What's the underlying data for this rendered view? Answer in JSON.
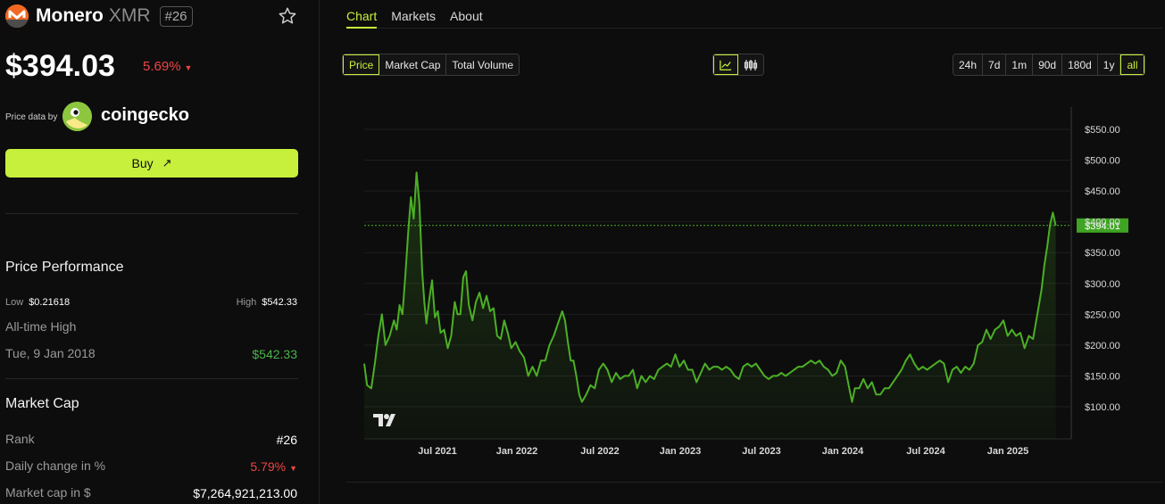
{
  "coin": {
    "name": "Monero",
    "symbol": "XMR",
    "rank": "#26",
    "price": "$394.03",
    "change": "5.69%",
    "price_data_by": "Price data by",
    "provider": "coingecko",
    "buy_label": "Buy",
    "brand_color": "#f26822",
    "accent_color": "#c7f03c"
  },
  "performance": {
    "title": "Price Performance",
    "low_label": "Low",
    "low_value": "$0.21618",
    "high_label": "High",
    "high_value": "$542.33",
    "ath_label": "All-time High",
    "ath_date": "Tue, 9 Jan 2018",
    "ath_value": "$542.33"
  },
  "market_cap": {
    "title": "Market Cap",
    "rank_label": "Rank",
    "rank_value": "#26",
    "daily_label": "Daily change in %",
    "daily_value": "5.79%",
    "cap_label": "Market cap in $",
    "cap_value": "$7,264,921,213.00"
  },
  "tabs": [
    "Chart",
    "Markets",
    "About"
  ],
  "metric_buttons": [
    "Price",
    "Market Cap",
    "Total Volume"
  ],
  "chart_type_icons": [
    "line-chart-icon",
    "candlestick-icon"
  ],
  "range_buttons": [
    "24h",
    "7d",
    "1m",
    "90d",
    "180d",
    "1y",
    "all"
  ],
  "chart_data": {
    "type": "area",
    "x_ticks": [
      "Jul 2021",
      "Jan 2022",
      "Jul 2022",
      "Jan 2023",
      "Jul 2023",
      "Jan 2024",
      "Jul 2024",
      "Jan 2025"
    ],
    "y_ticks": [
      "$550.00",
      "$500.00",
      "$450.00",
      "$400.00",
      "$350.00",
      "$300.00",
      "$250.00",
      "$200.00",
      "$150.00",
      "$100.00"
    ],
    "current_price_label": "$394.01",
    "current_price": 394.01,
    "ylim": [
      50,
      570
    ],
    "xlim": [
      0,
      1
    ],
    "series_color": "#4caf25",
    "points": [
      [
        0.0,
        170
      ],
      [
        0.004,
        135
      ],
      [
        0.01,
        130
      ],
      [
        0.015,
        170
      ],
      [
        0.02,
        215
      ],
      [
        0.025,
        250
      ],
      [
        0.03,
        200
      ],
      [
        0.036,
        215
      ],
      [
        0.042,
        240
      ],
      [
        0.046,
        225
      ],
      [
        0.05,
        265
      ],
      [
        0.054,
        250
      ],
      [
        0.058,
        310
      ],
      [
        0.062,
        380
      ],
      [
        0.066,
        440
      ],
      [
        0.07,
        405
      ],
      [
        0.074,
        480
      ],
      [
        0.078,
        430
      ],
      [
        0.082,
        320
      ],
      [
        0.085,
        270
      ],
      [
        0.088,
        235
      ],
      [
        0.092,
        275
      ],
      [
        0.096,
        305
      ],
      [
        0.1,
        245
      ],
      [
        0.104,
        255
      ],
      [
        0.108,
        220
      ],
      [
        0.113,
        225
      ],
      [
        0.118,
        195
      ],
      [
        0.123,
        215
      ],
      [
        0.128,
        270
      ],
      [
        0.132,
        250
      ],
      [
        0.136,
        250
      ],
      [
        0.14,
        310
      ],
      [
        0.144,
        320
      ],
      [
        0.148,
        265
      ],
      [
        0.153,
        240
      ],
      [
        0.158,
        270
      ],
      [
        0.163,
        285
      ],
      [
        0.168,
        260
      ],
      [
        0.173,
        280
      ],
      [
        0.178,
        255
      ],
      [
        0.183,
        260
      ],
      [
        0.188,
        215
      ],
      [
        0.193,
        210
      ],
      [
        0.198,
        240
      ],
      [
        0.203,
        220
      ],
      [
        0.208,
        195
      ],
      [
        0.214,
        205
      ],
      [
        0.22,
        190
      ],
      [
        0.226,
        180
      ],
      [
        0.232,
        150
      ],
      [
        0.238,
        165
      ],
      [
        0.244,
        150
      ],
      [
        0.25,
        175
      ],
      [
        0.256,
        175
      ],
      [
        0.262,
        200
      ],
      [
        0.268,
        215
      ],
      [
        0.274,
        235
      ],
      [
        0.28,
        255
      ],
      [
        0.284,
        240
      ],
      [
        0.288,
        205
      ],
      [
        0.292,
        175
      ],
      [
        0.296,
        175
      ],
      [
        0.3,
        150
      ],
      [
        0.304,
        120
      ],
      [
        0.308,
        108
      ],
      [
        0.314,
        120
      ],
      [
        0.32,
        135
      ],
      [
        0.326,
        130
      ],
      [
        0.332,
        160
      ],
      [
        0.338,
        170
      ],
      [
        0.344,
        160
      ],
      [
        0.35,
        140
      ],
      [
        0.356,
        155
      ],
      [
        0.362,
        145
      ],
      [
        0.368,
        150
      ],
      [
        0.374,
        150
      ],
      [
        0.38,
        160
      ],
      [
        0.386,
        130
      ],
      [
        0.392,
        150
      ],
      [
        0.398,
        140
      ],
      [
        0.404,
        150
      ],
      [
        0.41,
        145
      ],
      [
        0.416,
        160
      ],
      [
        0.422,
        165
      ],
      [
        0.428,
        170
      ],
      [
        0.434,
        165
      ],
      [
        0.44,
        185
      ],
      [
        0.446,
        165
      ],
      [
        0.452,
        175
      ],
      [
        0.458,
        160
      ],
      [
        0.464,
        160
      ],
      [
        0.47,
        140
      ],
      [
        0.476,
        155
      ],
      [
        0.482,
        170
      ],
      [
        0.488,
        160
      ],
      [
        0.494,
        165
      ],
      [
        0.5,
        165
      ],
      [
        0.506,
        160
      ],
      [
        0.512,
        165
      ],
      [
        0.518,
        160
      ],
      [
        0.524,
        150
      ],
      [
        0.53,
        145
      ],
      [
        0.536,
        165
      ],
      [
        0.542,
        170
      ],
      [
        0.548,
        165
      ],
      [
        0.554,
        170
      ],
      [
        0.56,
        160
      ],
      [
        0.566,
        150
      ],
      [
        0.572,
        145
      ],
      [
        0.578,
        150
      ],
      [
        0.584,
        150
      ],
      [
        0.59,
        155
      ],
      [
        0.596,
        150
      ],
      [
        0.602,
        155
      ],
      [
        0.608,
        160
      ],
      [
        0.614,
        165
      ],
      [
        0.62,
        165
      ],
      [
        0.626,
        170
      ],
      [
        0.632,
        175
      ],
      [
        0.638,
        170
      ],
      [
        0.644,
        175
      ],
      [
        0.65,
        165
      ],
      [
        0.656,
        160
      ],
      [
        0.662,
        150
      ],
      [
        0.668,
        155
      ],
      [
        0.674,
        175
      ],
      [
        0.68,
        165
      ],
      [
        0.686,
        130
      ],
      [
        0.69,
        108
      ],
      [
        0.694,
        130
      ],
      [
        0.7,
        130
      ],
      [
        0.706,
        145
      ],
      [
        0.712,
        130
      ],
      [
        0.718,
        140
      ],
      [
        0.724,
        120
      ],
      [
        0.73,
        120
      ],
      [
        0.736,
        130
      ],
      [
        0.742,
        130
      ],
      [
        0.748,
        140
      ],
      [
        0.754,
        150
      ],
      [
        0.76,
        160
      ],
      [
        0.766,
        175
      ],
      [
        0.772,
        185
      ],
      [
        0.778,
        170
      ],
      [
        0.784,
        160
      ],
      [
        0.79,
        165
      ],
      [
        0.796,
        160
      ],
      [
        0.802,
        165
      ],
      [
        0.808,
        170
      ],
      [
        0.814,
        175
      ],
      [
        0.82,
        170
      ],
      [
        0.826,
        140
      ],
      [
        0.832,
        160
      ],
      [
        0.838,
        165
      ],
      [
        0.844,
        155
      ],
      [
        0.85,
        165
      ],
      [
        0.856,
        160
      ],
      [
        0.862,
        170
      ],
      [
        0.868,
        200
      ],
      [
        0.874,
        205
      ],
      [
        0.88,
        225
      ],
      [
        0.886,
        210
      ],
      [
        0.892,
        225
      ],
      [
        0.898,
        230
      ],
      [
        0.904,
        240
      ],
      [
        0.91,
        215
      ],
      [
        0.916,
        225
      ],
      [
        0.922,
        215
      ],
      [
        0.928,
        220
      ],
      [
        0.934,
        195
      ],
      [
        0.94,
        215
      ],
      [
        0.946,
        210
      ],
      [
        0.952,
        250
      ],
      [
        0.958,
        290
      ],
      [
        0.962,
        330
      ],
      [
        0.966,
        360
      ],
      [
        0.97,
        395
      ],
      [
        0.974,
        415
      ],
      [
        0.978,
        394
      ]
    ]
  }
}
